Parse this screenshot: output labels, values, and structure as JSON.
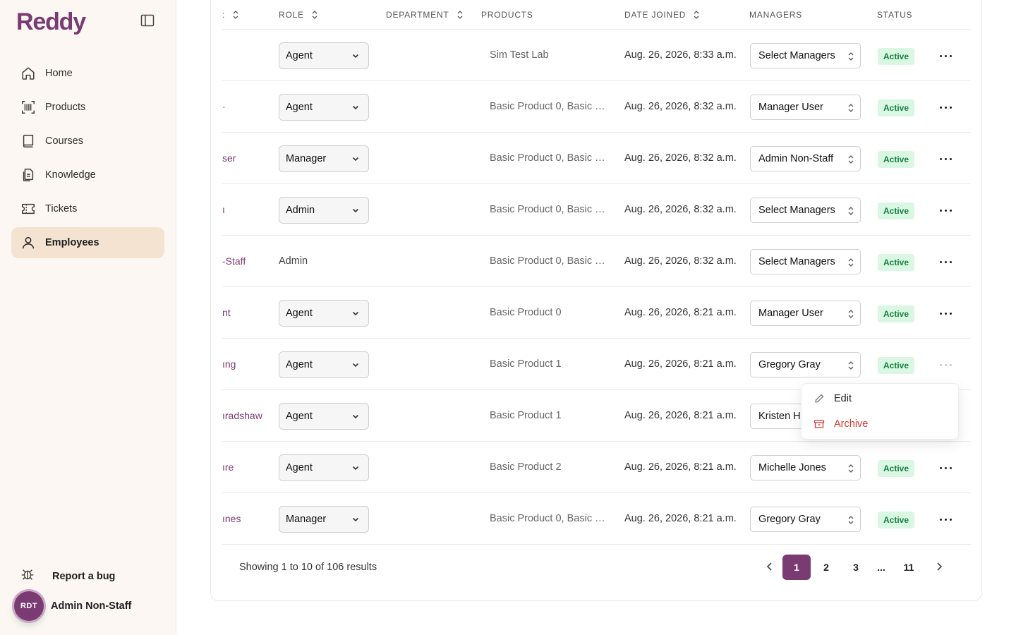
{
  "sidebar": {
    "brand": "Reddy",
    "items": [
      {
        "label": "Home",
        "icon": "home-icon"
      },
      {
        "label": "Products",
        "icon": "barcode-icon"
      },
      {
        "label": "Courses",
        "icon": "book-icon"
      },
      {
        "label": "Knowledge",
        "icon": "document-icon"
      },
      {
        "label": "Tickets",
        "icon": "ticket-icon"
      },
      {
        "label": "Employees",
        "icon": "user-icon",
        "active": true
      }
    ],
    "report_bug": "Report a bug",
    "user": {
      "initials": "RDT",
      "name": "Admin Non-Staff"
    }
  },
  "table": {
    "headers": {
      "name_partial": "",
      "role": "ROLE",
      "department": "DEPARTMENT",
      "products": "PRODUCTS",
      "date_joined": "DATE JOINED",
      "managers": "MANAGERS",
      "status": "STATUS"
    },
    "rows": [
      {
        "name": "",
        "role": "Agent",
        "role_editable": true,
        "products": "Sim Test Lab",
        "date": "Aug. 26, 2026, 8:33 a.m.",
        "managers": "Select Managers",
        "status": "Active"
      },
      {
        "name": "·",
        "role": "Agent",
        "role_editable": true,
        "products": "Basic Product 0, Basic P…",
        "date": "Aug. 26, 2026, 8:32 a.m.",
        "managers": "Manager User",
        "status": "Active"
      },
      {
        "name": "ser",
        "role": "Manager",
        "role_editable": true,
        "products": "Basic Product 0, Basic P…",
        "date": "Aug. 26, 2026, 8:32 a.m.",
        "managers": "Admin Non-Staff",
        "status": "Active"
      },
      {
        "name": "ı",
        "role": "Admin",
        "role_editable": true,
        "products": "Basic Product 0, Basic P…",
        "date": "Aug. 26, 2026, 8:32 a.m.",
        "managers": "Select Managers",
        "status": "Active"
      },
      {
        "name": "-Staff",
        "role": "Admin",
        "role_editable": false,
        "products": "Basic Product 0, Basic P…",
        "date": "Aug. 26, 2026, 8:32 a.m.",
        "managers": "Select Managers",
        "status": "Active"
      },
      {
        "name": "nt",
        "role": "Agent",
        "role_editable": true,
        "products": "Basic Product 0",
        "date": "Aug. 26, 2026, 8:21 a.m.",
        "managers": "Manager User",
        "status": "Active"
      },
      {
        "name": "ıng",
        "role": "Agent",
        "role_editable": true,
        "products": "Basic Product 1",
        "date": "Aug. 26, 2026, 8:21 a.m.",
        "managers": "Gregory Gray",
        "status": "Active",
        "menu_open": true
      },
      {
        "name": "ıradshaw",
        "role": "Agent",
        "role_editable": true,
        "products": "Basic Product 1",
        "date": "Aug. 26, 2026, 8:21 a.m.",
        "managers": "Kristen Ha",
        "status": ""
      },
      {
        "name": "ıre",
        "role": "Agent",
        "role_editable": true,
        "products": "Basic Product 2",
        "date": "Aug. 26, 2026, 8:21 a.m.",
        "managers": "Michelle Jones",
        "status": "Active"
      },
      {
        "name": "ınes",
        "role": "Manager",
        "role_editable": true,
        "products": "Basic Product 0, Basic P…",
        "date": "Aug. 26, 2026, 8:21 a.m.",
        "managers": "Gregory Gray",
        "status": "Active"
      }
    ]
  },
  "footer": {
    "summary": "Showing 1 to 10 of 106 results",
    "pages": [
      "1",
      "2",
      "3",
      "...",
      "11"
    ],
    "current_page": "1"
  },
  "context_menu": {
    "edit": "Edit",
    "archive": "Archive"
  },
  "colors": {
    "brand": "#7a3a72",
    "active_badge_bg": "#d9f7e3",
    "active_badge_text": "#17803f",
    "archive_red": "#d03a2f",
    "sidebar_bg": "#fcf7f2",
    "nav_active_bg": "#f5e3d2"
  }
}
